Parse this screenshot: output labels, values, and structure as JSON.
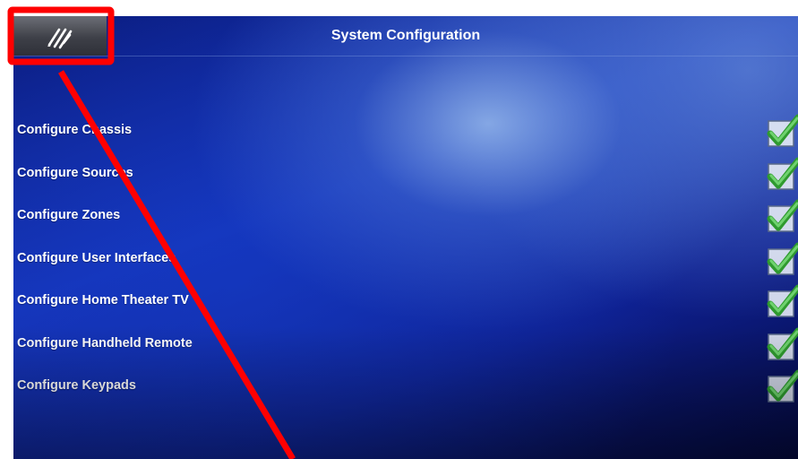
{
  "header": {
    "title": "System Configuration",
    "home_button_icon": "logo-icon"
  },
  "config_items": [
    {
      "label": "Configure Chassis",
      "status": "configured",
      "status_icon": "checkmark-icon"
    },
    {
      "label": "Configure Sources",
      "status": "configured",
      "status_icon": "checkmark-icon"
    },
    {
      "label": "Configure Zones",
      "status": "configured",
      "status_icon": "checkmark-icon"
    },
    {
      "label": "Configure User Interfaces",
      "status": "configured",
      "status_icon": "checkmark-icon"
    },
    {
      "label": "Configure Home Theater TV",
      "status": "configured",
      "status_icon": "checkmark-icon"
    },
    {
      "label": "Configure Handheld Remote",
      "status": "configured",
      "status_icon": "checkmark-icon"
    },
    {
      "label": "Configure Keypads",
      "status": "configured",
      "status_icon": "checkmark-icon"
    }
  ],
  "annotation": {
    "color": "#ff0000",
    "shape": "highlight-box-with-arrow",
    "target": "home-button"
  }
}
